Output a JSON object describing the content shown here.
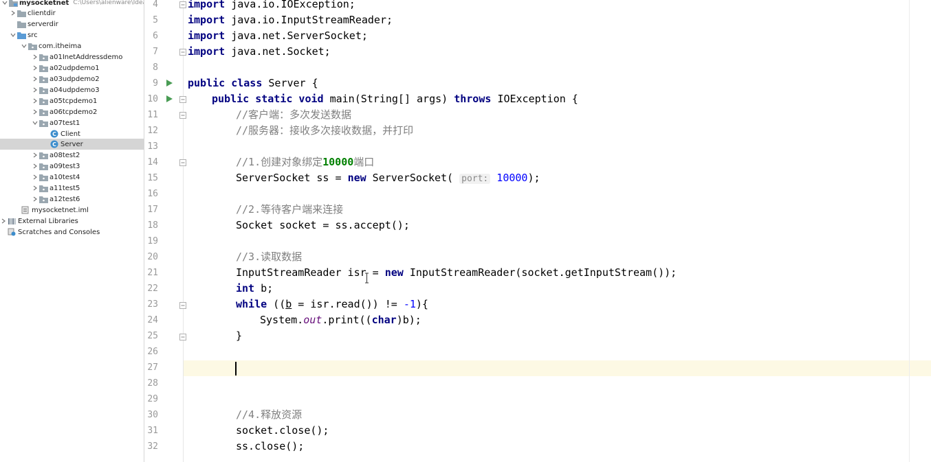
{
  "project_tree": {
    "root": {
      "name": "mysocketnet",
      "path": "C:\\Users\\alienware\\Ideal"
    },
    "items": [
      {
        "label": "clientdir",
        "type": "folder"
      },
      {
        "label": "serverdir",
        "type": "folder"
      },
      {
        "label": "src",
        "type": "source-folder"
      },
      {
        "label": "com.itheima",
        "type": "package"
      },
      {
        "label": "a01InetAddressdemo",
        "type": "package"
      },
      {
        "label": "a02udpdemo1",
        "type": "package"
      },
      {
        "label": "a03udpdemo2",
        "type": "package"
      },
      {
        "label": "a04udpdemo3",
        "type": "package"
      },
      {
        "label": "a05tcpdemo1",
        "type": "package"
      },
      {
        "label": "a06tcpdemo2",
        "type": "package"
      },
      {
        "label": "a07test1",
        "type": "package"
      },
      {
        "label": "Client",
        "type": "class"
      },
      {
        "label": "Server",
        "type": "class",
        "selected": true
      },
      {
        "label": "a08test2",
        "type": "package"
      },
      {
        "label": "a09test3",
        "type": "package"
      },
      {
        "label": "a10test4",
        "type": "package"
      },
      {
        "label": "a11test5",
        "type": "package"
      },
      {
        "label": "a12test6",
        "type": "package"
      },
      {
        "label": "mysocketnet.iml",
        "type": "iml-file"
      },
      {
        "label": "External Libraries",
        "type": "libraries"
      },
      {
        "label": "Scratches and Consoles",
        "type": "scratches"
      }
    ]
  },
  "editor": {
    "line_numbers": [
      "4",
      "5",
      "6",
      "7",
      "8",
      "9",
      "10",
      "11",
      "12",
      "13",
      "14",
      "15",
      "16",
      "17",
      "18",
      "19",
      "20",
      "21",
      "22",
      "23",
      "24",
      "25",
      "26",
      "27",
      "28",
      "29",
      "30",
      "31",
      "32"
    ],
    "current_line": "27",
    "code": {
      "l4": {
        "kw": "import",
        "rest": " java.io.IOException;"
      },
      "l5": {
        "kw": "import",
        "rest": " java.io.InputStreamReader;"
      },
      "l6": {
        "kw": "import",
        "rest": " java.net.ServerSocket;"
      },
      "l7": {
        "kw": "import",
        "rest": " java.net.Socket;"
      },
      "l9": {
        "kw": "public class",
        "rest": " Server {"
      },
      "l10": {
        "kw1": "public static void",
        "mid": " main(String[] args) ",
        "kw2": "throws",
        "rest": " IOException {"
      },
      "l11": {
        "comment": "//客户端：多次发送数据"
      },
      "l12": {
        "comment": "//服务器：接收多次接收数据，并打印"
      },
      "l14": {
        "comment_a": "//1.创建对象绑定",
        "comment_num": "10000",
        "comment_b": "端口"
      },
      "l15": {
        "a": "ServerSocket ss = ",
        "kw": "new",
        "b": " ServerSocket(",
        "hint": "port:",
        "num": "10000",
        "c": ");"
      },
      "l17": {
        "comment": "//2.等待客户端来连接"
      },
      "l18": {
        "text": "Socket socket = ss.accept();"
      },
      "l20": {
        "comment": "//3.读取数据"
      },
      "l21": {
        "a": "InputStreamReader isr = ",
        "kw": "new",
        "b": " InputStreamReader(socket.getInputStream());"
      },
      "l22": {
        "kw": "int",
        "rest": " b;"
      },
      "l23": {
        "kw": "while",
        "a": " ((",
        "var": "b",
        "b": " = isr.read()) != ",
        "num": "-1",
        "c": "){"
      },
      "l24": {
        "a": "System.",
        "static": "out",
        "b": ".print((",
        "kw": "char",
        "c": ")b);"
      },
      "l25": {
        "text": "}"
      },
      "l30": {
        "comment": "//4.释放资源"
      },
      "l31": {
        "text": "socket.close();"
      },
      "l32": {
        "text": "ss.close();"
      }
    }
  },
  "colors": {
    "keyword": "#000080",
    "comment": "#808080",
    "number": "#0000ff",
    "static_field": "#660e7a",
    "current_line": "#fdf9e4",
    "selected_row": "#d5d5d5",
    "run_icon": "#499c54",
    "folder": "#9aa7b0",
    "package": "#9aa7b0",
    "source_folder": "#5a9bd5",
    "class_icon": "#3c8dcc"
  },
  "icons": {
    "folder": "folder-icon",
    "package": "package-icon",
    "class": "java-class-icon",
    "run": "run-gutter-icon",
    "fold": "fold-icon",
    "expand": "chevron-right-icon",
    "collapse": "chevron-down-icon"
  }
}
